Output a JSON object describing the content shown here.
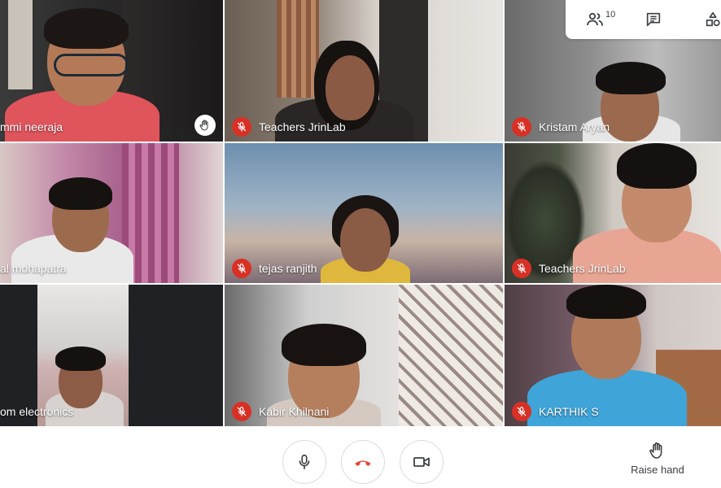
{
  "participants": [
    {
      "name": "mmi neeraja",
      "muted": false,
      "hand_raised": true
    },
    {
      "name": "Teachers JrinLab",
      "muted": true,
      "hand_raised": false
    },
    {
      "name": "Kristam Aryan",
      "muted": true,
      "hand_raised": false
    },
    {
      "name": "al mohapatra",
      "muted": false,
      "hand_raised": false
    },
    {
      "name": "tejas ranjith",
      "muted": true,
      "hand_raised": false
    },
    {
      "name": "Teachers JrinLab",
      "muted": true,
      "hand_raised": false
    },
    {
      "name": "om electronics",
      "muted": false,
      "hand_raised": false
    },
    {
      "name": "Kabir Khilnani",
      "muted": true,
      "hand_raised": false
    },
    {
      "name": "KARTHIK S",
      "muted": true,
      "hand_raised": false
    }
  ],
  "topbar": {
    "participant_count": "10",
    "icons": [
      "people-icon",
      "chat-icon",
      "activities-icon"
    ]
  },
  "controls": {
    "raise_hand_label": "Raise hand",
    "icons": [
      "microphone-icon",
      "hang-up-icon",
      "camera-icon"
    ]
  },
  "colors": {
    "muted_red": "#d93025",
    "hangup_red": "#ea4335",
    "icon_gray": "#3c4043"
  }
}
